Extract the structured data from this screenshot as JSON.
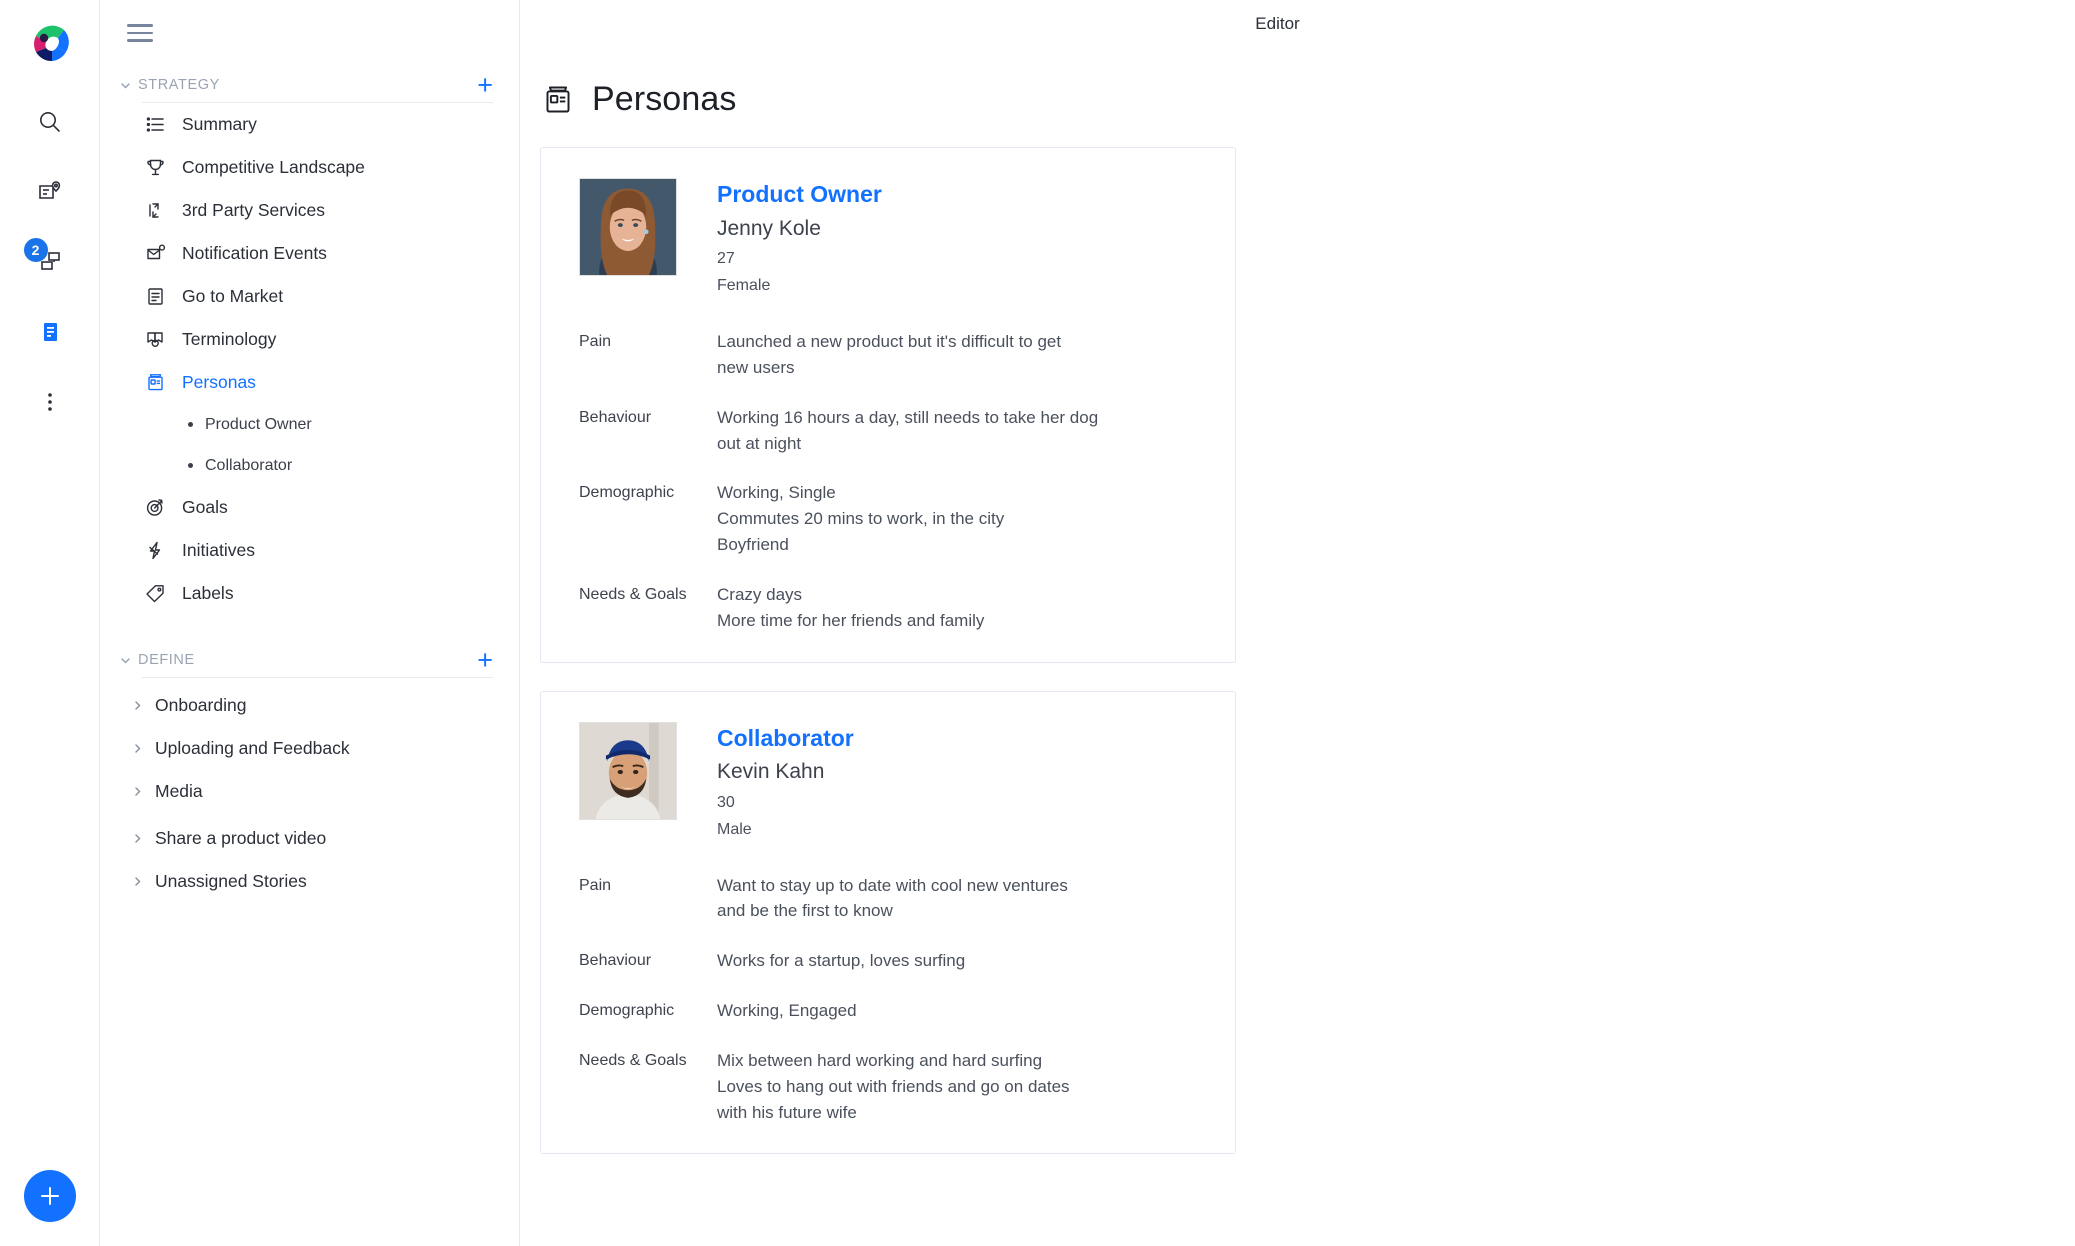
{
  "rail": {
    "logo": "craft-logo",
    "items": [
      {
        "name": "search-icon",
        "badge": null
      },
      {
        "name": "map-document-icon",
        "badge": null
      },
      {
        "name": "board-icon",
        "badge": "2"
      },
      {
        "name": "document-icon",
        "badge": null
      },
      {
        "name": "more-options-icon",
        "badge": null
      }
    ],
    "fab_label": "+"
  },
  "sidebar": {
    "menu_icon": "hamburger-icon",
    "sections": [
      {
        "title": "STRATEGY",
        "add_label": "+",
        "items": [
          {
            "label": "Summary",
            "icon": "list-icon",
            "active": false
          },
          {
            "label": "Competitive Landscape",
            "icon": "trophy-icon",
            "active": false
          },
          {
            "label": "3rd Party Services",
            "icon": "integration-icon",
            "active": false
          },
          {
            "label": "Notification Events",
            "icon": "notification-mail-icon",
            "active": false
          },
          {
            "label": "Go to Market",
            "icon": "document-lines-icon",
            "active": false
          },
          {
            "label": "Terminology",
            "icon": "book-search-icon",
            "active": false
          },
          {
            "label": "Personas",
            "icon": "persona-card-icon",
            "active": true,
            "children": [
              "Product Owner",
              "Collaborator"
            ]
          },
          {
            "label": "Goals",
            "icon": "target-icon",
            "active": false
          },
          {
            "label": "Initiatives",
            "icon": "bolt-icon",
            "active": false
          },
          {
            "label": "Labels",
            "icon": "tag-icon",
            "active": false
          }
        ]
      },
      {
        "title": "DEFINE",
        "add_label": "+",
        "collapsed_items": [
          {
            "label": "Onboarding"
          },
          {
            "label": "Uploading and Feedback"
          },
          {
            "label": "Media"
          },
          {
            "label": "Share a product video"
          },
          {
            "label": "Unassigned Stories"
          }
        ]
      }
    ]
  },
  "main": {
    "top_label": "Editor",
    "page_icon": "persona-card-icon",
    "page_title": "Personas",
    "attribute_labels": [
      "Pain",
      "Behaviour",
      "Demographic",
      "Needs & Goals"
    ],
    "cards": [
      {
        "role": "Product Owner",
        "name": "Jenny Kole",
        "age": "27",
        "gender": "Female",
        "avatar": "photo-woman-brown-hair",
        "attributes": [
          {
            "label": "Pain",
            "lines": [
              "Launched a new product but it's difficult to get",
              "new users"
            ]
          },
          {
            "label": "Behaviour",
            "lines": [
              "Working 16 hours a day, still needs to take her dog",
              "out at night"
            ]
          },
          {
            "label": "Demographic",
            "lines": [
              "Working, Single",
              "Commutes 20 mins to work, in the city",
              "Boyfriend"
            ]
          },
          {
            "label": "Needs & Goals",
            "lines": [
              "Crazy days",
              "More time for her friends and family"
            ]
          }
        ]
      },
      {
        "role": "Collaborator",
        "name": "Kevin Kahn",
        "age": "30",
        "gender": "Male",
        "avatar": "photo-man-blue-cap",
        "attributes": [
          {
            "label": "Pain",
            "lines": [
              "Want to stay up to date with cool new ventures",
              "and be the first to know"
            ]
          },
          {
            "label": "Behaviour",
            "lines": [
              "Works for a startup, loves surfing"
            ]
          },
          {
            "label": "Demographic",
            "lines": [
              "Working, Engaged"
            ]
          },
          {
            "label": "Needs & Goals",
            "lines": [
              "Mix between hard working and hard surfing",
              "Loves to hang out with friends and go on dates",
              "with his future wife"
            ]
          }
        ]
      }
    ]
  },
  "colors": {
    "accent": "#1271ff",
    "text": "#2b2f38",
    "muted": "#9aa3b2",
    "border": "#e8eaee",
    "card_border": "#e2e7f0"
  }
}
